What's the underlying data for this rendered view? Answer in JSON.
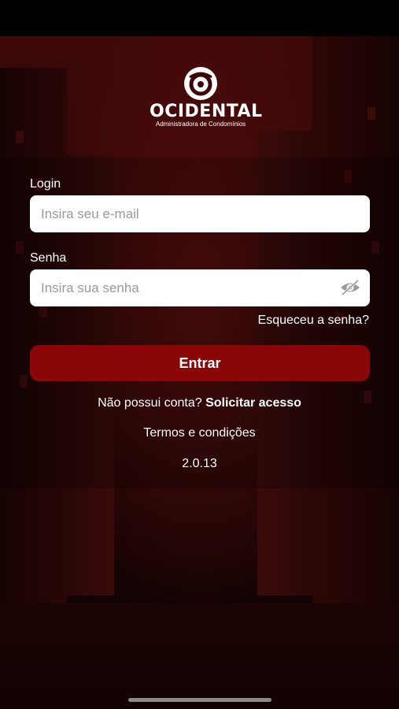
{
  "brand": {
    "name": "OCIDENTAL",
    "tagline": "Administradora de Condomínios"
  },
  "login": {
    "label": "Login",
    "placeholder": "Insira seu e-mail"
  },
  "password": {
    "label": "Senha",
    "placeholder": "Insira sua senha",
    "toggle_icon": "eye-off-icon"
  },
  "forgot_password": "Esqueceu a senha?",
  "submit_button": "Entrar",
  "signup": {
    "prompt": "Não possui conta?",
    "link": "Solicitar acesso"
  },
  "terms_link": "Termos e condições",
  "version": "2.0.13",
  "colors": {
    "primary": "#8b0606",
    "background": "#2c0606",
    "input_bg": "#ffffff"
  }
}
